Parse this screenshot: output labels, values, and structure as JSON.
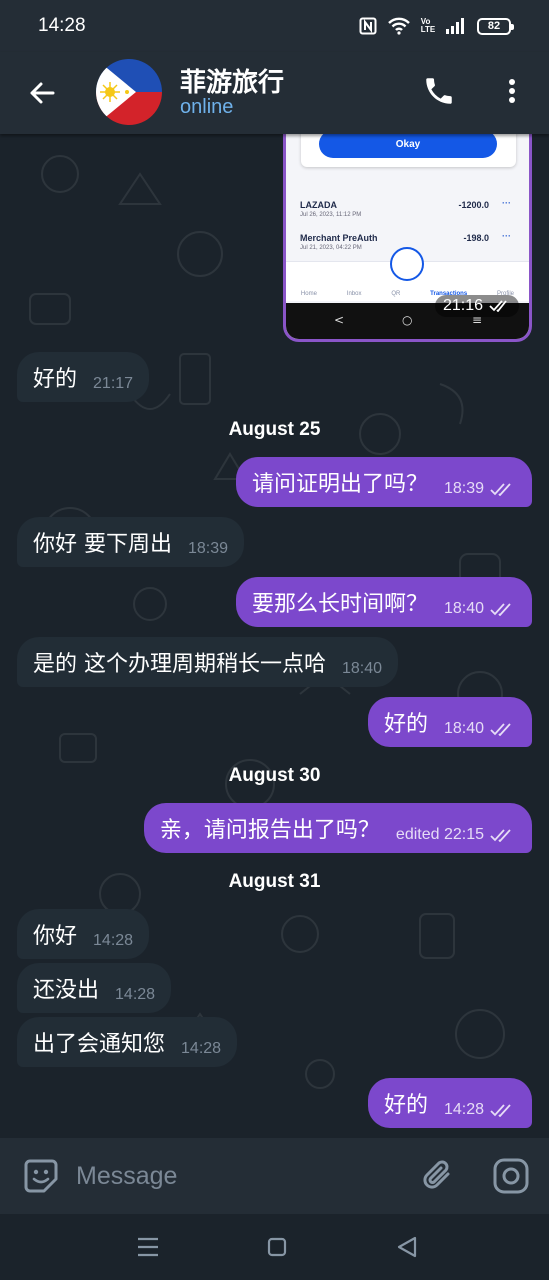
{
  "status_bar": {
    "time": "14:28",
    "battery": "82",
    "volte": "Vo LTE"
  },
  "header": {
    "title": "菲游旅行",
    "status": "online"
  },
  "image_message": {
    "popup_button": "Okay",
    "rows": [
      {
        "name": "LAZADA",
        "date": "Jul 26, 2023, 11:12 PM",
        "amount": "-1200.0"
      },
      {
        "name": "Merchant PreAuth",
        "date": "Jul 21, 2023, 04:22 PM",
        "amount": "-198.0"
      }
    ],
    "nav": [
      "Home",
      "Inbox",
      "QR",
      "Transactions",
      "Profile"
    ],
    "time": "21:16"
  },
  "messages": [
    {
      "dir": "in",
      "text": "好的",
      "time": "21:17"
    },
    {
      "date": "August 25"
    },
    {
      "dir": "out",
      "text": "请问证明出了吗？",
      "time": "18:39"
    },
    {
      "dir": "in",
      "text": "你好 要下周出",
      "time": "18:39"
    },
    {
      "dir": "out",
      "text": "要那么长时间啊？",
      "time": "18:40"
    },
    {
      "dir": "in",
      "text": "是的 这个办理周期稍长一点哈",
      "time": "18:40"
    },
    {
      "dir": "out",
      "text": "好的",
      "time": "18:40"
    },
    {
      "date": "August 30"
    },
    {
      "dir": "out",
      "text": "亲，请问报告出了吗？",
      "time": "edited 22:15"
    },
    {
      "date": "August 31"
    },
    {
      "dir": "in",
      "text": "你好",
      "time": "14:28"
    },
    {
      "dir": "in",
      "text": "还没出",
      "time": "14:28"
    },
    {
      "dir": "in",
      "text": "出了会通知您",
      "time": "14:28"
    },
    {
      "dir": "out",
      "text": "好的",
      "time": "14:28"
    }
  ],
  "composer": {
    "placeholder": "Message"
  },
  "colors": {
    "outgoing_bubble": "#7c48cc",
    "incoming_bubble": "#222d36",
    "status_link": "#6fb1ea",
    "header_bg": "#242d36"
  }
}
